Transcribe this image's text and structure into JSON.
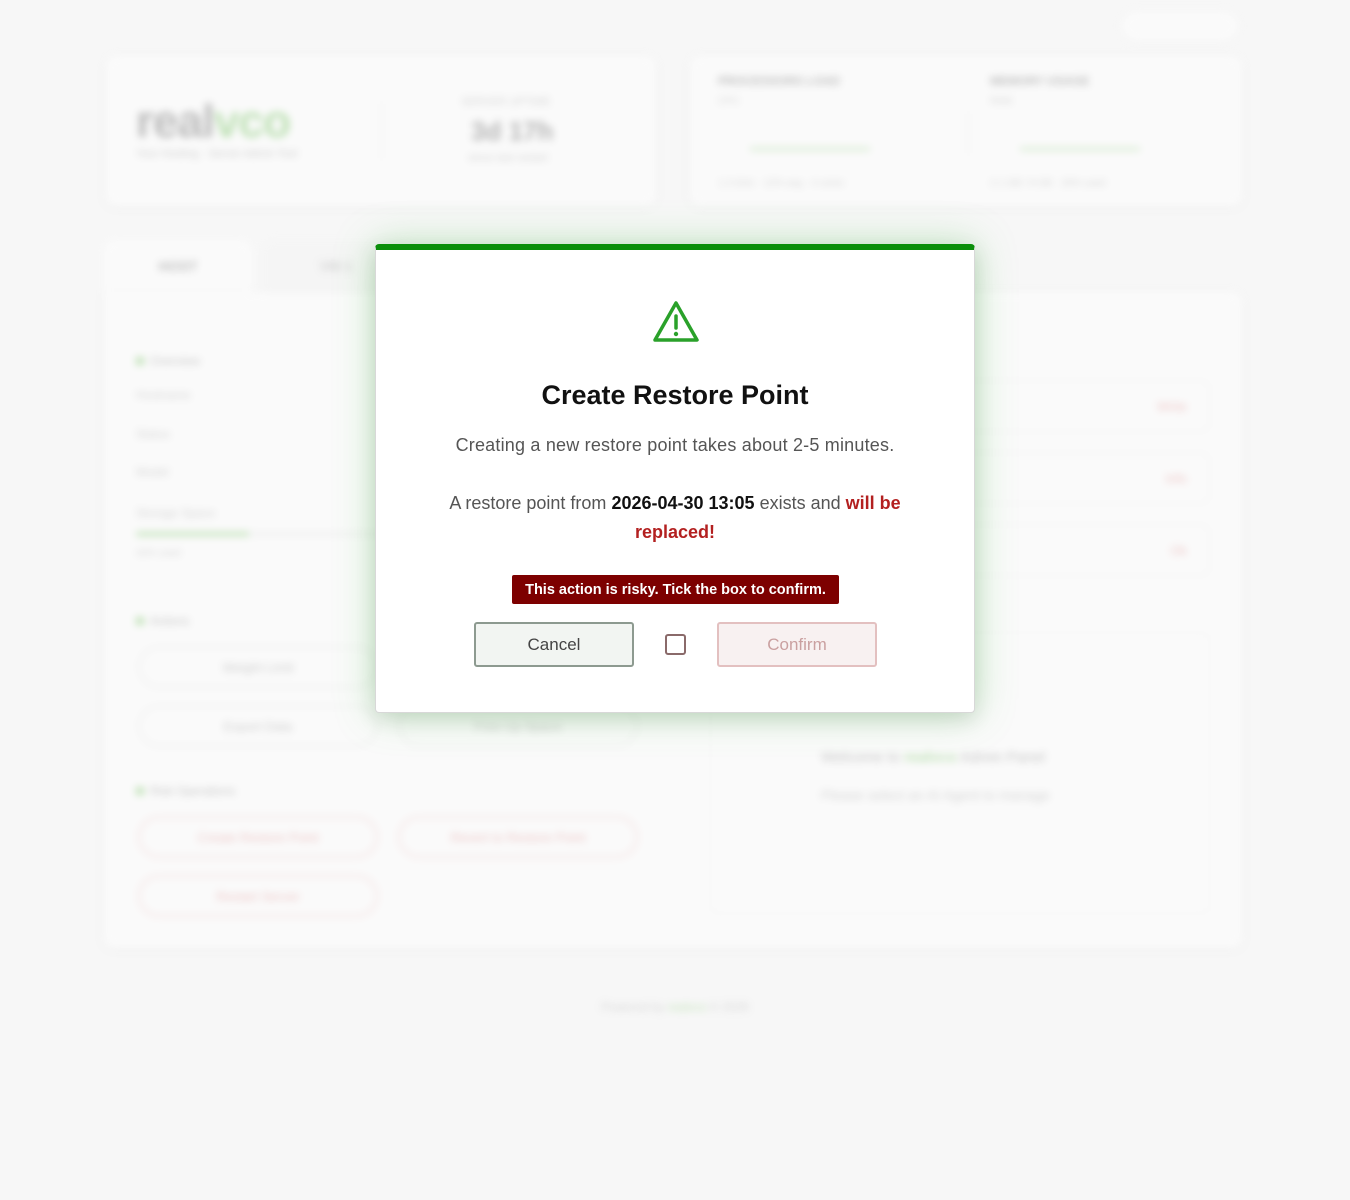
{
  "background": {
    "logo_part1": "real",
    "logo_part2": "vco",
    "logo_sub": "Your Hosting · Server Admin Tool",
    "uptime_label": "SERVER UPTIME",
    "uptime_value": "3d 17h",
    "uptime_sub": "since last restart",
    "metrics": [
      {
        "title": "PROCESSORS LOAD",
        "sub": "CPU",
        "foot": "1.3 GHz · 12% avg · 4 cores"
      },
      {
        "title": "MEMORY USAGE",
        "sub": "RAM",
        "foot": "2.1 GB / 8 GB · 26% used"
      }
    ],
    "tabs": [
      "HOST",
      "VM 1"
    ],
    "sections": {
      "overview": "Overview",
      "actions": "Actions",
      "risk": "Risk Operations"
    },
    "rows": [
      "Hostname",
      "Status",
      "Model",
      "Storage Space",
      "42% used"
    ],
    "buttons": [
      "Weight Limit",
      "Export Data",
      "Free Up Space"
    ],
    "danger_buttons": [
      "Create Restore Point",
      "Revert to Restore Point",
      "Restart Server"
    ],
    "stats": [
      "Write",
      "Info",
      "Ok"
    ],
    "welcome_prefix": "Welcome to ",
    "welcome_brand": "realvco",
    "welcome_suffix": " Admin Panel",
    "welcome_sub": "Please select an AI Agent to manage",
    "footer_prefix": "Powered by ",
    "footer_brand": "realvco",
    "footer_suffix": " © 2026"
  },
  "modal": {
    "icon": "warning-triangle-icon",
    "title": "Create Restore Point",
    "line1": "Creating a new restore point takes about 2-5 minutes.",
    "line2_prefix": "A restore point from ",
    "line2_date": "2026-04-30 13:05",
    "line2_middle": " exists and ",
    "line2_warning": "will be replaced!",
    "risk_notice": "This action is risky. Tick the box to confirm.",
    "cancel_label": "Cancel",
    "confirm_label": "Confirm",
    "confirm_checked": false
  },
  "colors": {
    "accent_green": "#0a8f0a",
    "danger_red": "#b32020",
    "risk_bg": "#7d0000"
  }
}
